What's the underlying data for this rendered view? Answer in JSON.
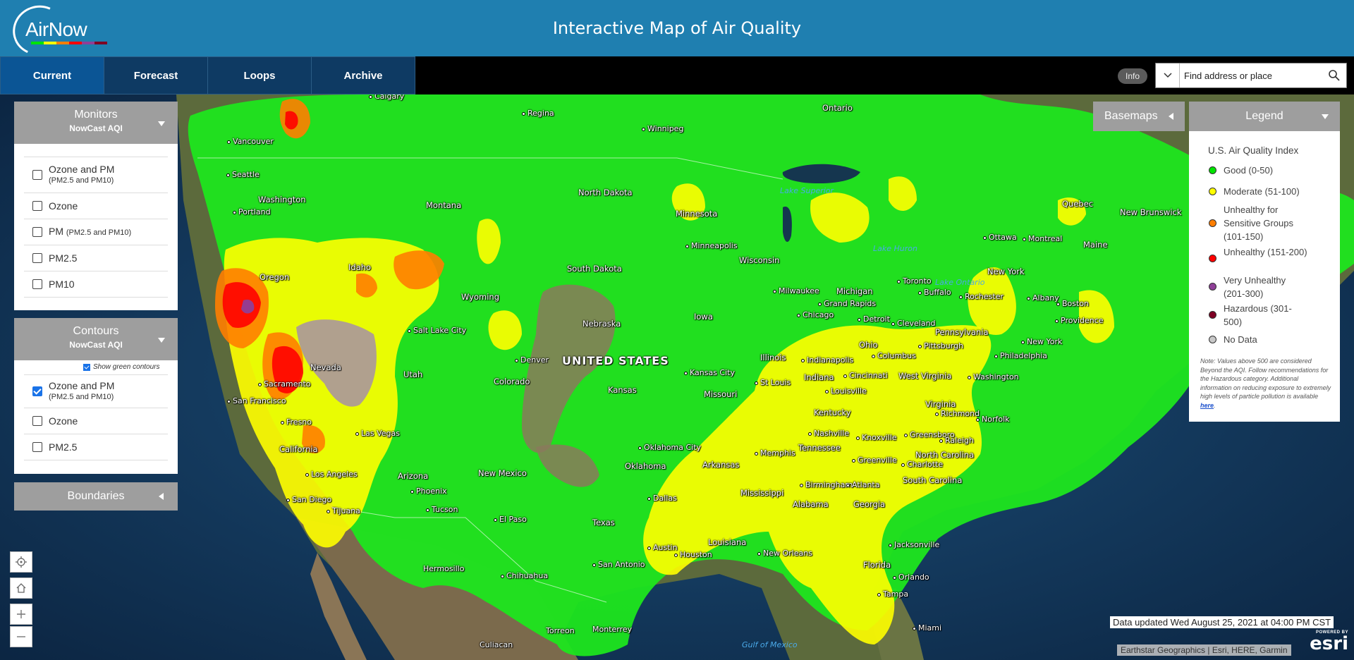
{
  "header": {
    "logo_text": "AirNow",
    "title": "Interactive Map of Air Quality",
    "logo_bar_colors": [
      "#00e400",
      "#ffff00",
      "#ff7e00",
      "#ff0000",
      "#8f3f97",
      "#7e0023"
    ]
  },
  "nav": {
    "tabs": [
      "Current",
      "Forecast",
      "Loops",
      "Archive"
    ],
    "active_tab": "Current",
    "info_label": "Info",
    "search_placeholder": "Find address or place"
  },
  "monitors": {
    "title": "Monitors",
    "subtitle": "NowCast AQI",
    "options": [
      {
        "label": "Ozone and PM",
        "sub": "(PM2.5 and PM10)",
        "checked": false
      },
      {
        "label": "Ozone",
        "checked": false
      },
      {
        "label": "PM",
        "inline": "(PM2.5 and PM10)",
        "checked": false
      },
      {
        "label": "PM2.5",
        "checked": false
      },
      {
        "label": "PM10",
        "checked": false
      }
    ]
  },
  "contours": {
    "title": "Contours",
    "subtitle": "NowCast AQI",
    "show_green_label": "Show green contours",
    "show_green_checked": true,
    "options": [
      {
        "label": "Ozone and PM",
        "sub": "(PM2.5 and PM10)",
        "checked": true
      },
      {
        "label": "Ozone",
        "checked": false
      },
      {
        "label": "PM2.5",
        "checked": false
      }
    ]
  },
  "boundaries": {
    "title": "Boundaries"
  },
  "basemaps": {
    "title": "Basemaps"
  },
  "legend": {
    "title": "Legend",
    "index_title": "U.S. Air Quality Index",
    "items": [
      {
        "label": "Good (0-50)",
        "color": "#00e400"
      },
      {
        "label": "Moderate (51-100)",
        "color": "#ffff00"
      },
      {
        "label": "Unhealthy for Sensitive Groups (101-150)",
        "color": "#ff7e00"
      },
      {
        "label": "Unhealthy (151-200)",
        "color": "#ff0000"
      },
      {
        "label": "Very Unhealthy (201-300)",
        "color": "#8f3f97"
      },
      {
        "label": "Hazardous (301-500)",
        "color": "#7e0023"
      },
      {
        "label": "No Data",
        "color": "#c8c8c8"
      }
    ],
    "note_text": "Note: Values above 500 are considered Beyond the AQI. Follow recommendations for the Hazardous category. Additional information on reducing exposure to extremely high levels of particle pollution is available ",
    "note_link": "here",
    "note_end": "."
  },
  "map": {
    "country_label": "UNITED STATES",
    "states": [
      "Washington",
      "Oregon",
      "Idaho",
      "Montana",
      "Wyoming",
      "Nevada",
      "Utah",
      "Colorado",
      "California",
      "Arizona",
      "New Mexico",
      "North Dakota",
      "South Dakota",
      "Nebraska",
      "Kansas",
      "Oklahoma",
      "Texas",
      "Minnesota",
      "Iowa",
      "Missouri",
      "Arkansas",
      "Louisiana",
      "Wisconsin",
      "Illinois",
      "Michigan",
      "Indiana",
      "Ohio",
      "Kentucky",
      "Tennessee",
      "Mississippi",
      "Alabama",
      "Georgia",
      "Florida",
      "South Carolina",
      "North Carolina",
      "Virginia",
      "West Virginia",
      "Pennsylvania",
      "New York",
      "Maine",
      "Ontario",
      "Quebec",
      "New Brunswick"
    ],
    "cities": [
      "Calgary",
      "Regina",
      "Winnipeg",
      "Vancouver",
      "Seattle",
      "Portland",
      "Sacramento",
      "San Francisco",
      "Fresno",
      "Los Angeles",
      "San Diego",
      "Tijuana",
      "Las Vegas",
      "Phoenix",
      "Tucson",
      "Salt Lake City",
      "Denver",
      "El Paso",
      "Hermosillo",
      "Chihuahua",
      "Torreon",
      "Culiacan",
      "Monterrey",
      "Oklahoma City",
      "Dallas",
      "Austin",
      "San Antonio",
      "Houston",
      "New Orleans",
      "Memphis",
      "Nashville",
      "Birmingham",
      "Atlanta",
      "Knoxville",
      "Greenville",
      "Charlotte",
      "Greensboro",
      "Raleigh",
      "Richmond",
      "Norfolk",
      "Washington",
      "Philadelphia",
      "New York",
      "Boston",
      "Providence",
      "Albany",
      "Rochester",
      "Buffalo",
      "Toronto",
      "Ottawa",
      "Montreal",
      "Detroit",
      "Cleveland",
      "Pittsburgh",
      "Columbus",
      "Cincinnati",
      "Louisville",
      "Indianapolis",
      "Chicago",
      "Milwaukee",
      "Grand Rapids",
      "Minneapolis",
      "Kansas City",
      "St Louis",
      "Jacksonville",
      "Orlando",
      "Tampa",
      "Miami"
    ],
    "waters": [
      "Lake Superior",
      "Lake Huron",
      "Lake Ontario",
      "Gulf of Mexico"
    ]
  },
  "footer": {
    "updated": "Data updated Wed August 25, 2021 at 04:00 PM CST",
    "attribution": "Earthstar Geographics | Esri, HERE, Garmin",
    "powered_by": "POWERED BY",
    "esri": "esri"
  }
}
